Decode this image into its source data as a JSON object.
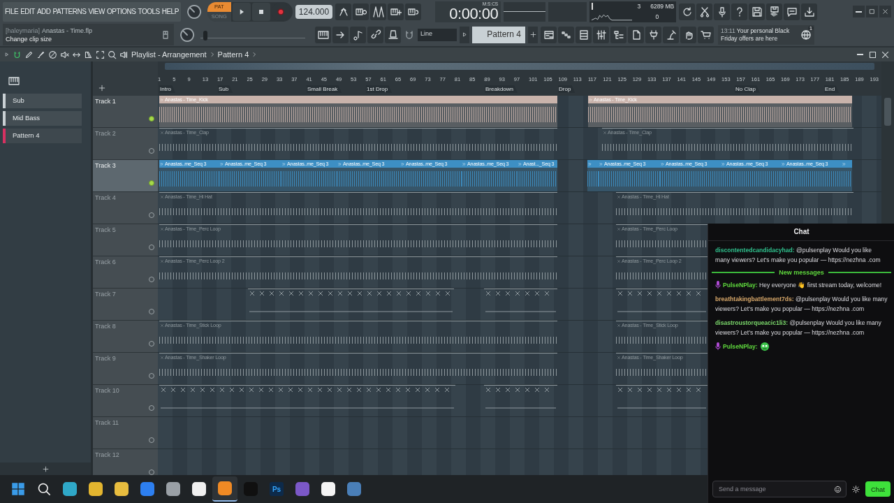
{
  "menu": [
    "FILE",
    "EDIT",
    "ADD",
    "PATTERNS",
    "VIEW",
    "OPTIONS",
    "TOOLS",
    "HELP"
  ],
  "transport": {
    "modes": [
      {
        "label": "PAT",
        "selected": true
      },
      {
        "label": "SONG",
        "selected": false
      }
    ],
    "tempo": "124.000"
  },
  "time": {
    "value": "0:00:00",
    "unit": "M:S:CS"
  },
  "monitor": {
    "voices": "3",
    "memory": "6289 MB",
    "polyphony": "0"
  },
  "hint": {
    "user": "[haleymaria]",
    "file": "Anastas - Time.flp",
    "message": "Change clip size"
  },
  "master_pitch": {
    "level": 0.03
  },
  "snap": "Line",
  "pattern_selector": "Pattern 4",
  "news": {
    "time": "13:11",
    "text": "Your personal Black Friday offers are here",
    "badge": "1"
  },
  "playlist": {
    "title": "Playlist - Arrangement",
    "pattern": "Pattern 4"
  },
  "patterns": [
    {
      "name": "Sub",
      "selected": false
    },
    {
      "name": "Mid Bass",
      "selected": false
    },
    {
      "name": "Pattern 4",
      "selected": true
    }
  ],
  "ruler": {
    "bars": [
      "1",
      "5",
      "9",
      "13",
      "17",
      "21",
      "25",
      "29",
      "33",
      "37",
      "41",
      "45",
      "49",
      "53",
      "57",
      "61",
      "65",
      "69",
      "73",
      "77",
      "81",
      "85",
      "89",
      "93",
      "97",
      "101",
      "105",
      "109",
      "113",
      "117",
      "121",
      "125",
      "129",
      "133",
      "137",
      "141",
      "145",
      "149",
      "153",
      "157",
      "161",
      "165",
      "169",
      "173",
      "177",
      "181",
      "185",
      "189",
      "193"
    ],
    "markers": [
      "Intro",
      "Sub",
      "Small Break",
      "1st Drop",
      "Breakdown",
      "Drop",
      "No Clap",
      "End"
    ]
  },
  "tracks": [
    {
      "name": "Track 1",
      "enabled": true,
      "selected": false,
      "color": "#c9b3ab",
      "clips": [
        {
          "kind": "audio",
          "label": "Anastas - Time_Kick"
        },
        {
          "kind": "audio",
          "label": "Anastas - Time_Kick"
        }
      ]
    },
    {
      "name": "Track 2",
      "enabled": false,
      "selected": false,
      "color": "#8f999e",
      "clips": [
        {
          "kind": "audio",
          "label": "Anastas - Time_Clap"
        },
        {
          "kind": "audio",
          "label": "Anastas - Time_Clap"
        }
      ]
    },
    {
      "name": "Track 3",
      "enabled": true,
      "selected": true,
      "color": "#3d8fc4",
      "clips": [
        {
          "kind": "audio",
          "label": "Anastas..me_Seq 3"
        },
        {
          "kind": "audio",
          "label": "Anastas..me_Seq 3"
        },
        {
          "kind": "audio",
          "label": "Anastas..me_Seq 3"
        },
        {
          "kind": "audio",
          "label": "Anastas..me_Seq 3"
        },
        {
          "kind": "audio",
          "label": "Anastas..me_Seq 3"
        },
        {
          "kind": "audio",
          "label": "Anastas..me_Seq 3"
        },
        {
          "kind": "audio",
          "label": "Anast..._Seq 3"
        },
        {
          "kind": "audio"
        },
        {
          "kind": "audio",
          "label": "Anastas..me_Seq 3"
        },
        {
          "kind": "audio",
          "label": "Anastas..me_Seq 3"
        },
        {
          "kind": "audio",
          "label": "Anastas..me_Seq 3"
        },
        {
          "kind": "audio",
          "label": "Anastas..me_Seq 3"
        },
        {
          "kind": "audio"
        }
      ]
    },
    {
      "name": "Track 4",
      "enabled": false,
      "selected": false,
      "color": "#8f999e",
      "clips": [
        {
          "kind": "audio",
          "label": "Anastas - Time_Hi Hat"
        },
        {
          "kind": "audio",
          "label": "Anastas - Time_Hi Hat"
        }
      ]
    },
    {
      "name": "Track 5",
      "enabled": false,
      "selected": false,
      "color": "#8f999e",
      "clips": [
        {
          "kind": "audio",
          "label": "Anastas - Time_Perc Loop"
        },
        {
          "kind": "audio",
          "label": "Anastas - Time_Perc Loop"
        }
      ]
    },
    {
      "name": "Track 6",
      "enabled": false,
      "selected": false,
      "color": "#8f999e",
      "clips": [
        {
          "kind": "audio",
          "label": "Anastas - Time_Perc Loop 2"
        },
        {
          "kind": "audio",
          "label": "Anastas - Time_Perc Loop 2"
        }
      ]
    },
    {
      "name": "Track 7",
      "enabled": false,
      "selected": false,
      "color": "#8f999e",
      "clips": [
        {
          "kind": "pattern"
        },
        {
          "kind": "pattern"
        },
        {
          "kind": "pattern"
        }
      ]
    },
    {
      "name": "Track 8",
      "enabled": false,
      "selected": false,
      "color": "#8f999e",
      "clips": [
        {
          "kind": "audio",
          "label": "Anastas - Time_Stick Loop"
        },
        {
          "kind": "audio",
          "label": "Anastas - Time_Stick Loop"
        }
      ]
    },
    {
      "name": "Track 9",
      "enabled": false,
      "selected": false,
      "color": "#8f999e",
      "clips": [
        {
          "kind": "audio",
          "label": "Anastas - Time_Shaker Loop"
        },
        {
          "kind": "audio",
          "label": "Anastas - Time_Shaker Loop"
        }
      ]
    },
    {
      "name": "Track 10",
      "enabled": false,
      "selected": false,
      "color": "#8f999e",
      "clips": [
        {
          "kind": "pattern"
        },
        {
          "kind": "pattern"
        },
        {
          "kind": "pattern"
        }
      ]
    },
    {
      "name": "Track 11",
      "enabled": false,
      "selected": false
    },
    {
      "name": "Track 12",
      "enabled": false,
      "selected": false
    }
  ],
  "chat": {
    "title": "Chat",
    "messages": [
      {
        "kind": "text",
        "badge": false,
        "user": "discontentedcandidacyhad:",
        "color": "#2fbf8c",
        "text": "@pulsenplay Would you like many viewers? Let's make you popular — https://nezhna .com"
      },
      {
        "kind": "divider",
        "label": "New messages"
      },
      {
        "kind": "text",
        "badge": true,
        "user": "PulseNPlay:",
        "color": "#5fd93d",
        "text": "Hey everyone 👋 first stream today, welcome!"
      },
      {
        "kind": "text",
        "badge": false,
        "user": "breathtakingbattlement7ds:",
        "color": "#d8a86a",
        "text": "@pulsenplay Would you like many viewers? Let's make you popular — https://nezhna .com"
      },
      {
        "kind": "text",
        "badge": false,
        "user": "disastroustorqueacic1li3:",
        "color": "#7ad66a",
        "text": "@pulsenplay Would you like many viewers? Let's make you popular — https://nezhna .com"
      },
      {
        "kind": "emote",
        "badge": true,
        "user": "PulseNPlay:",
        "color": "#5fd93d"
      }
    ],
    "input": {
      "placeholder": "Send a message"
    },
    "send": "Chat"
  },
  "taskbar": [
    {
      "kind": "start",
      "selected": false
    },
    {
      "kind": "search",
      "selected": false
    },
    {
      "kind": "edge",
      "selected": false
    },
    {
      "kind": "chrome",
      "selected": false
    },
    {
      "kind": "folder",
      "selected": false
    },
    {
      "kind": "zoom",
      "selected": false
    },
    {
      "kind": "gear",
      "selected": false
    },
    {
      "kind": "app",
      "selected": false
    },
    {
      "kind": "fl",
      "selected": true
    },
    {
      "kind": "terminal",
      "selected": false
    },
    {
      "kind": "ps",
      "label": "Ps",
      "selected": false
    },
    {
      "kind": "viber",
      "selected": false
    },
    {
      "kind": "file",
      "selected": false
    },
    {
      "kind": "davinci",
      "selected": false
    }
  ]
}
